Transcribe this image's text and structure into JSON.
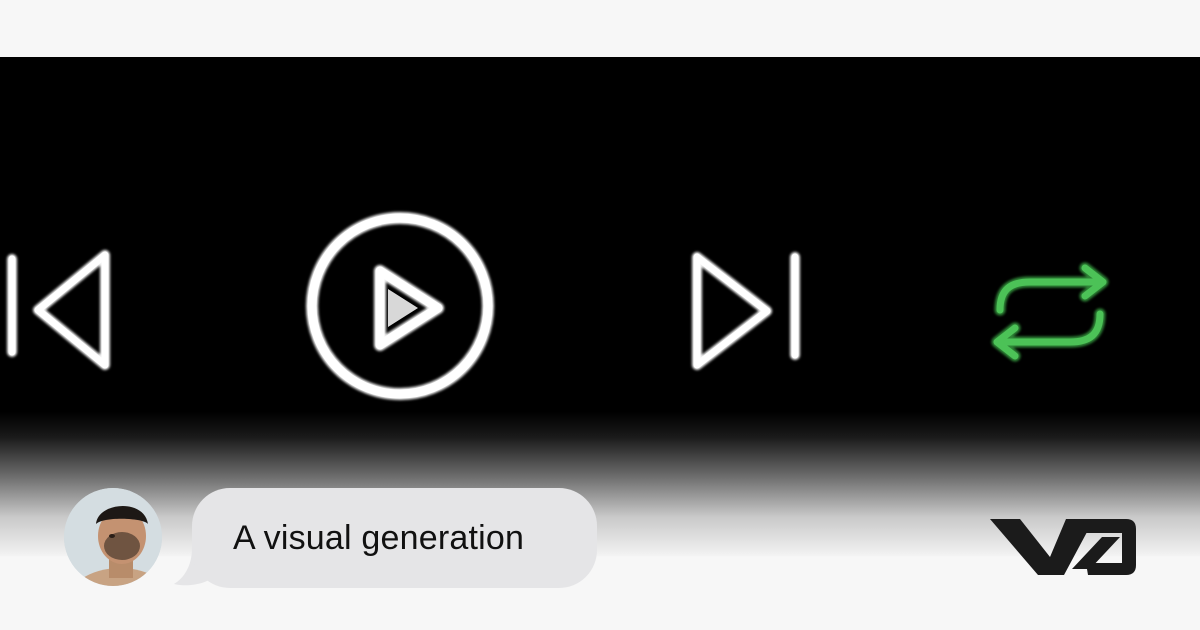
{
  "player": {
    "controls": [
      {
        "name": "previous-button",
        "icon": "skip-previous-icon"
      },
      {
        "name": "play-button",
        "icon": "play-circle-icon"
      },
      {
        "name": "next-button",
        "icon": "skip-next-icon"
      },
      {
        "name": "repeat-button",
        "icon": "repeat-icon",
        "active": true
      }
    ],
    "colors": {
      "background": "#000000",
      "icon": "#f2f2f2",
      "repeat_active": "#3aa845"
    }
  },
  "footer": {
    "avatar": {
      "icon": "user-avatar"
    },
    "bubble": {
      "text": "A visual generation",
      "background": "#e5e5e7"
    },
    "logo": {
      "icon": "brand-logo-icon",
      "color": "#1b1b1b"
    }
  }
}
